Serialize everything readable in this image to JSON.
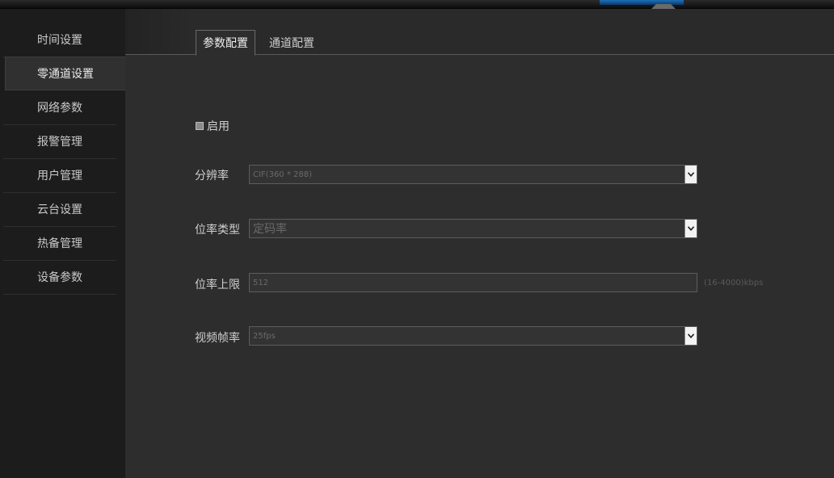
{
  "sidebar": {
    "items": [
      {
        "label": "时间设置"
      },
      {
        "label": "零通道设置"
      },
      {
        "label": "网络参数"
      },
      {
        "label": "报警管理"
      },
      {
        "label": "用户管理"
      },
      {
        "label": "云台设置"
      },
      {
        "label": "热备管理"
      },
      {
        "label": "设备参数"
      }
    ],
    "active": "零通道设置"
  },
  "tabs": [
    {
      "label": "参数配置"
    },
    {
      "label": "通道配置"
    }
  ],
  "form": {
    "enable_label": "启用",
    "resolution": {
      "label": "分辨率",
      "value": "CIF(360 * 288)"
    },
    "bitrate_type": {
      "label": "位率类型",
      "value": "定码率"
    },
    "bitrate_limit": {
      "label": "位率上限",
      "value": "512",
      "hint": "(16-4000)kbps"
    },
    "frame_rate": {
      "label": "视频帧率",
      "value": "25fps"
    }
  },
  "icons": {
    "dropdown": "chevron-down-icon",
    "checkbox": "checkbox-icon"
  }
}
